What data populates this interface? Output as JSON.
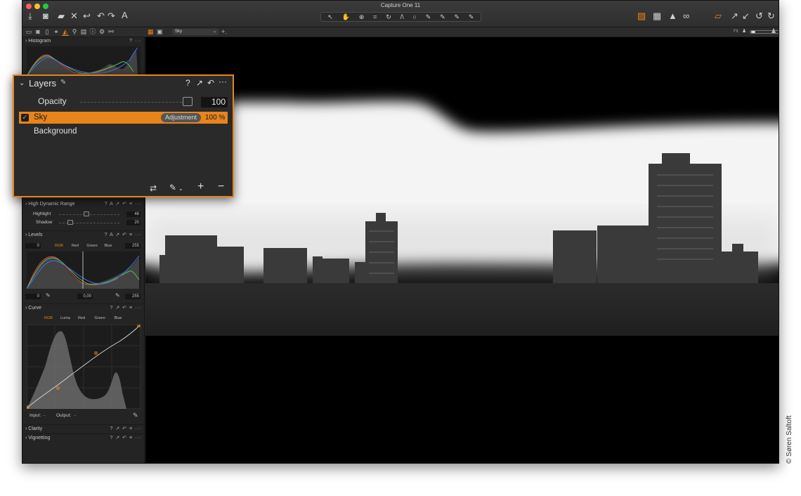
{
  "window": {
    "title": "Capture One 11"
  },
  "viewer_bar": {
    "variant_name": "Sky",
    "fit_label": "Fit"
  },
  "histogram": {
    "title": "Histogram"
  },
  "layers": {
    "title": "Layers",
    "help": "?",
    "opacity_label": "Opacity",
    "opacity_value": "100",
    "items": [
      {
        "name": "Sky",
        "badge": "Adjustment",
        "opacity": "100 %",
        "checked": true,
        "selected": true
      },
      {
        "name": "Background"
      }
    ]
  },
  "hdr": {
    "title": "High Dynamic Range",
    "rows": [
      {
        "label": "Highlight",
        "value": "46"
      },
      {
        "label": "Shadow",
        "value": "20"
      }
    ]
  },
  "levels": {
    "title": "Levels",
    "tabs": [
      "RGB",
      "Red",
      "Green",
      "Blue"
    ],
    "top_left": "0",
    "top_right": "255",
    "bottom_left": "0",
    "bottom_mid": "0,00",
    "bottom_right": "255"
  },
  "curve": {
    "title": "Curve",
    "tabs": [
      "RGB",
      "Luma",
      "Red",
      "Green",
      "Blue"
    ],
    "input_label": "Input:",
    "output_label": "Output:",
    "input_value": "–",
    "output_value": "–"
  },
  "clarity": {
    "title": "Clarity"
  },
  "vignetting": {
    "title": "Vignetting"
  },
  "credit": "© Søren Saltoft",
  "colors": {
    "accent": "#e8841b",
    "panel": "#262626",
    "viewer": "#000000"
  }
}
